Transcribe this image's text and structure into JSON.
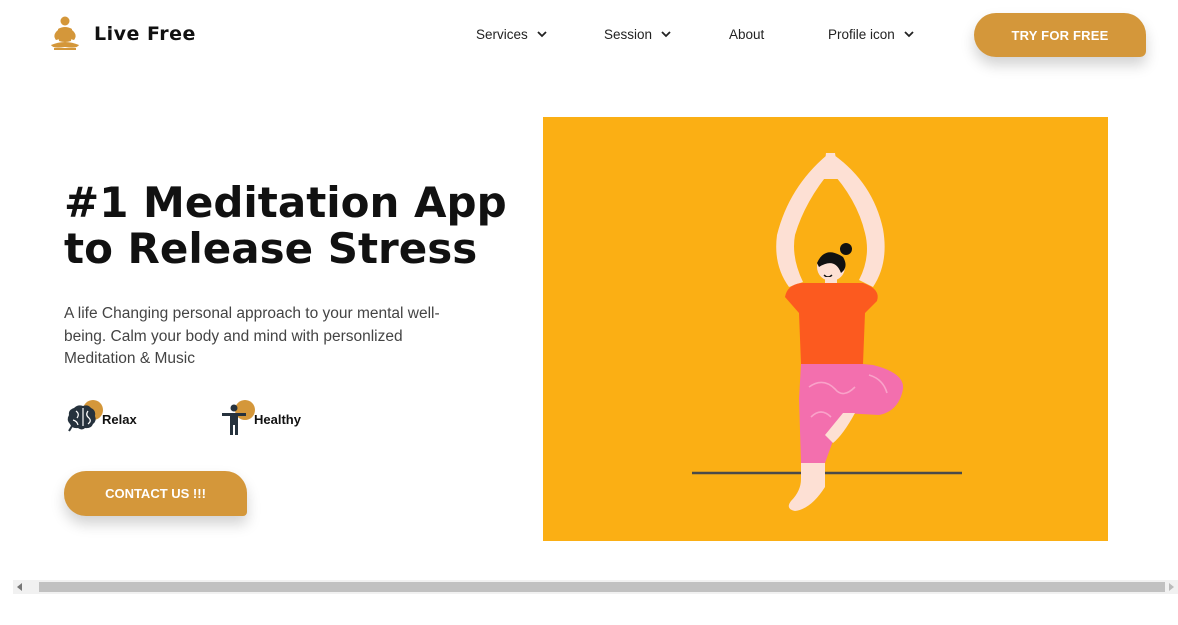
{
  "header": {
    "brand": "Live Free",
    "nav": [
      {
        "label": "Services",
        "dropdown": true
      },
      {
        "label": "Session",
        "dropdown": true
      },
      {
        "label": "About",
        "dropdown": false
      },
      {
        "label": "Profile icon",
        "dropdown": true
      }
    ],
    "cta_label": "TRY FOR FREE"
  },
  "hero": {
    "title_line1": "#1 Meditation App",
    "title_line2": "to Release Stress",
    "description": "A life Changing personal approach to your mental well-being. Calm your body and mind with personlized Meditation & Music",
    "features": [
      {
        "label": "Relax",
        "icon": "brain-icon"
      },
      {
        "label": "Healthy",
        "icon": "person-icon"
      }
    ],
    "contact_label": "CONTACT US !!!",
    "illustration": "yoga-tree-pose-illustration"
  },
  "colors": {
    "accent": "#d4973a",
    "illustration_bg": "#fbaf14",
    "shirt": "#fc5a1f",
    "pants": "#f36fae"
  }
}
